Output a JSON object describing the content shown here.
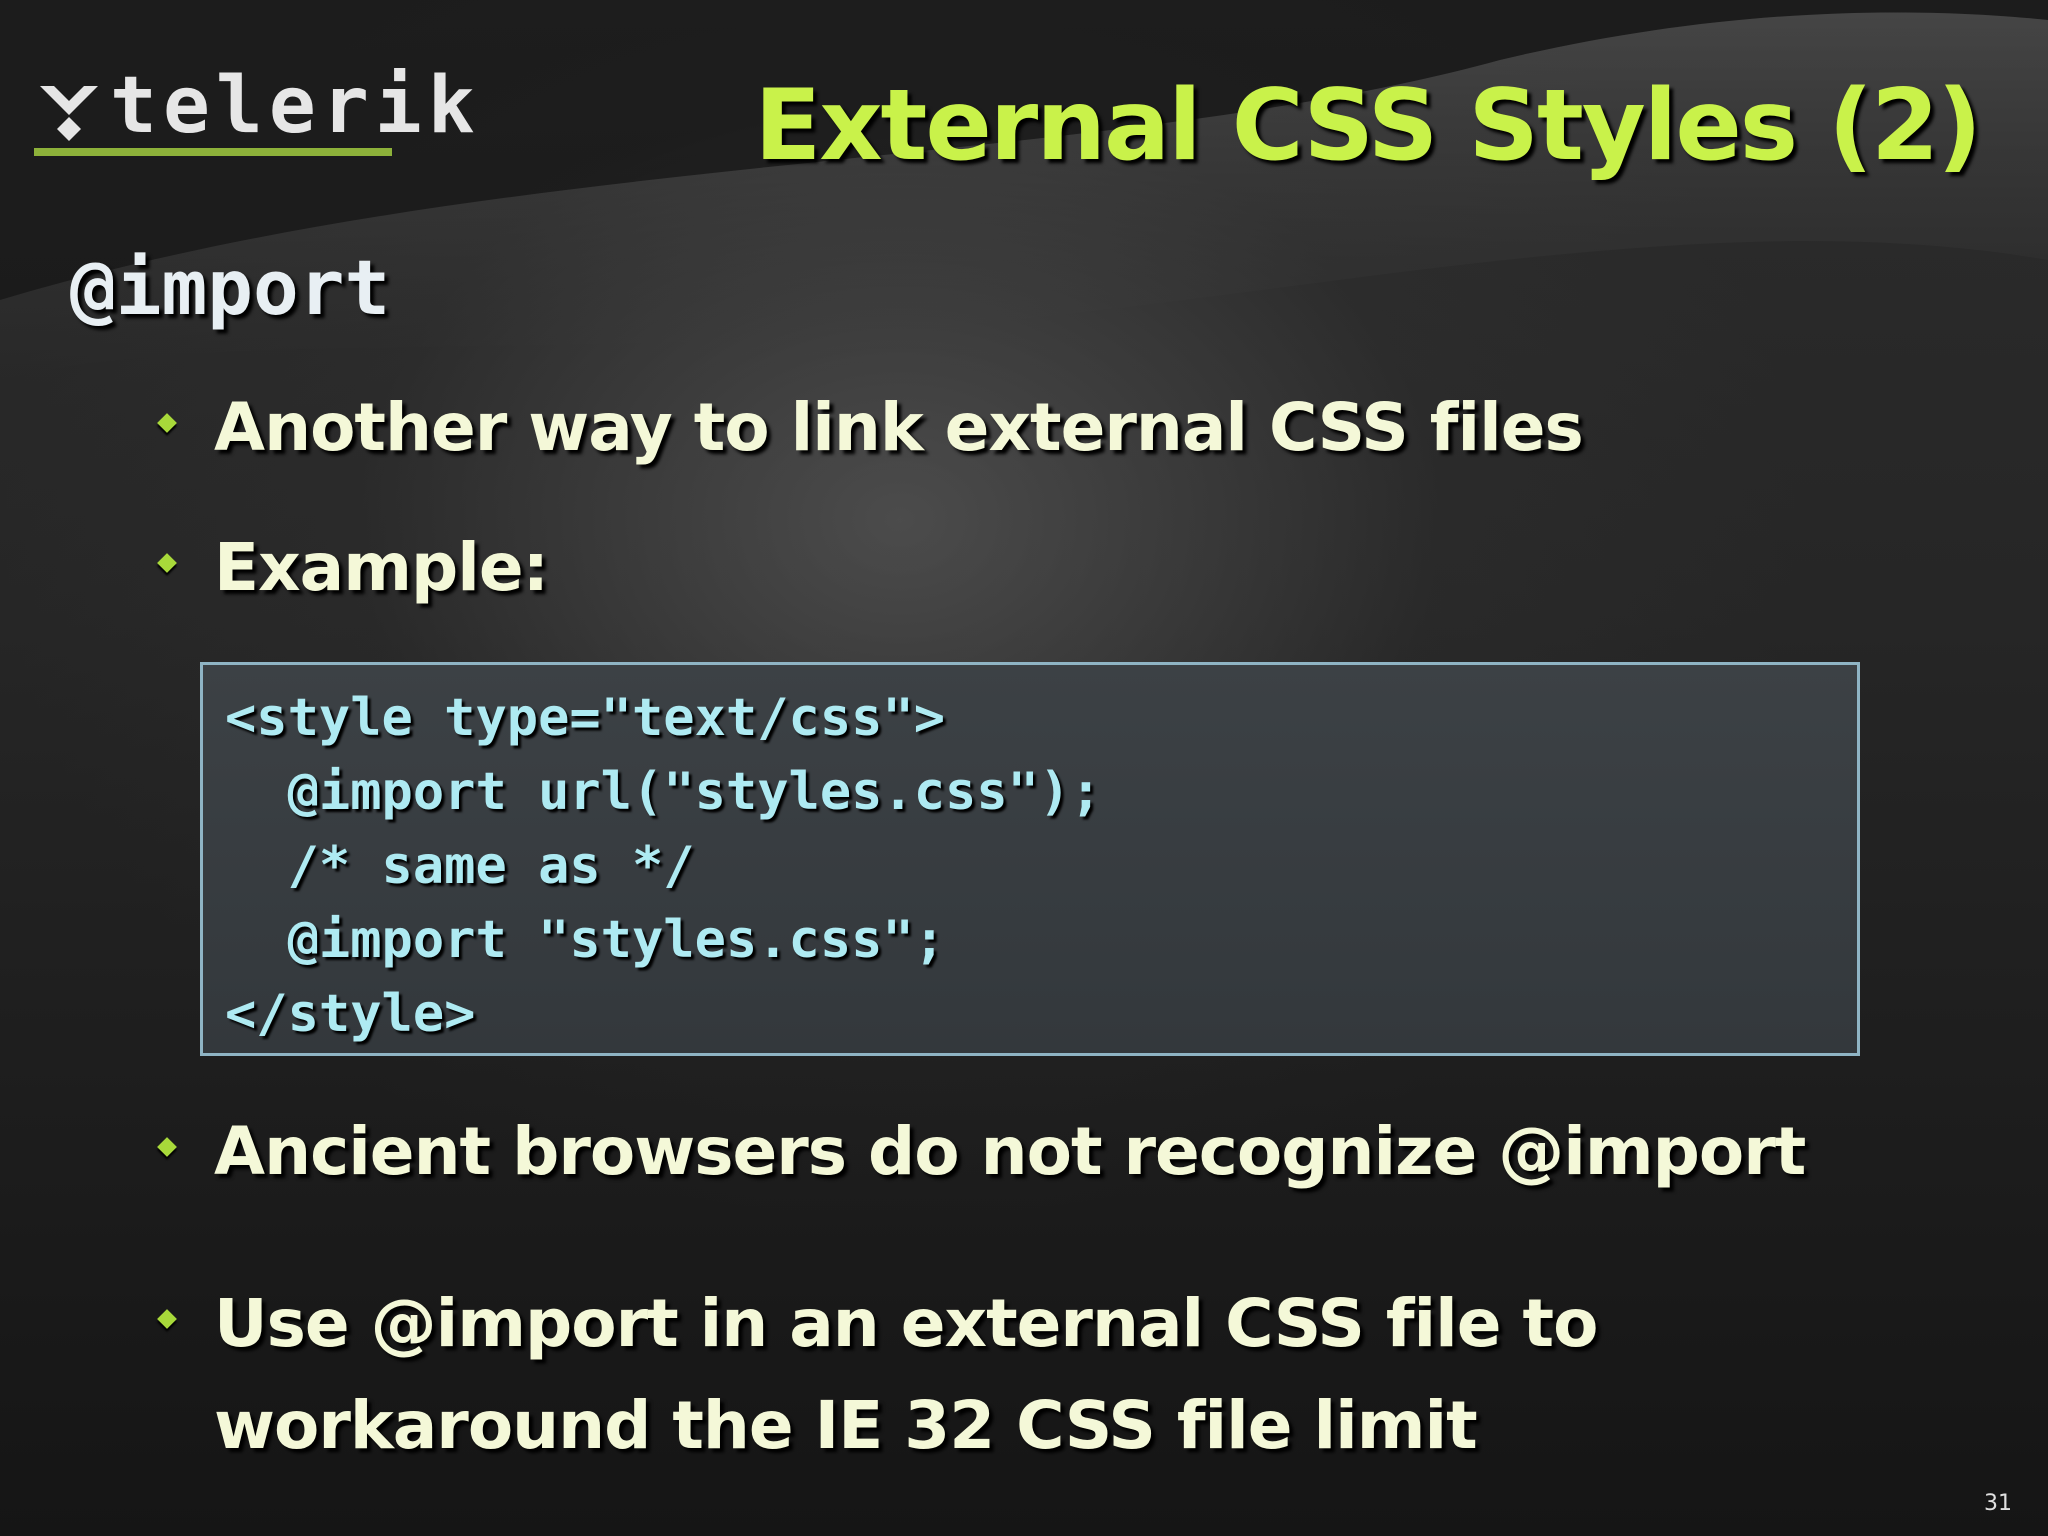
{
  "logo": {
    "text": "telerik",
    "accent_color": "#8db13a"
  },
  "title": "External CSS Styles (2)",
  "section_heading": "@import",
  "bullets": {
    "b1": "Another way to link external CSS files",
    "b2": "Example:",
    "b3": "Ancient browsers do not recognize @import",
    "b4_line1": "Use @import in an external CSS file to",
    "b4_line2": "workaround the IE 32 CSS file limit"
  },
  "code": {
    "line1": "<style type=\"text/css\">",
    "line2": "  @import url(\"styles.css\");",
    "line3": "  /* same as */",
    "line4": "  @import \"styles.css\";",
    "line5": "</style>"
  },
  "page_number": "31",
  "colors": {
    "title": "#c9f24a",
    "bullet_text": "#f4f8d8",
    "bullet_marker": "#a8d93a",
    "code_text": "#aeeaf2",
    "code_border": "#8fb4c4"
  }
}
